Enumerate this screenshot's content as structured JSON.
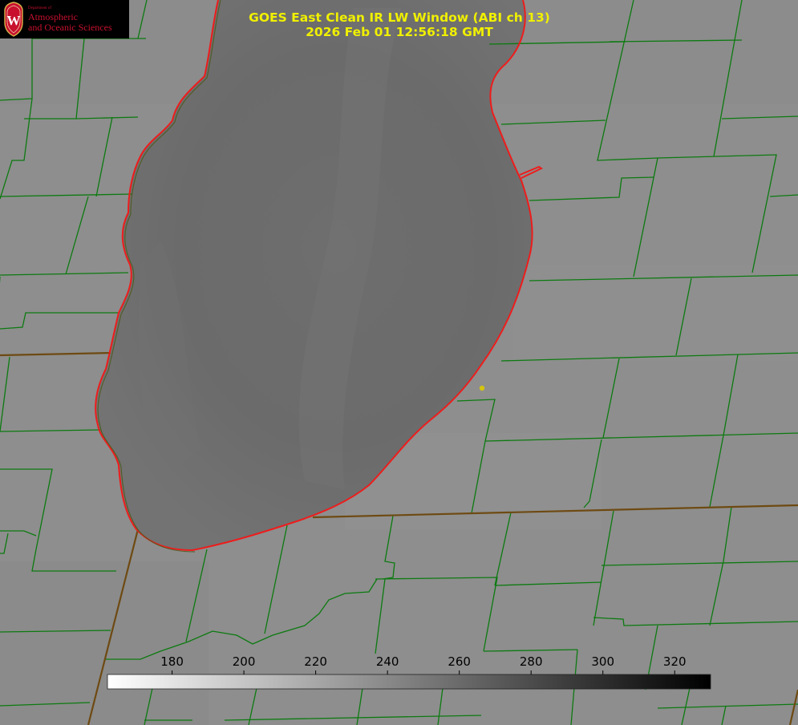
{
  "title": {
    "line1": "GOES East Clean IR LW Window (ABI ch 13)",
    "line2": "2026 Feb 01 12:56:18 GMT"
  },
  "logo": {
    "crest_letter": "W",
    "dept": "Department of",
    "line1": "Atmospheric",
    "line2": "and Oceanic Sciences"
  },
  "colorbar": {
    "min": 162,
    "max": 330,
    "ticks": [
      "180",
      "200",
      "220",
      "240",
      "260",
      "280",
      "300",
      "320"
    ],
    "tick_values": [
      180,
      200,
      220,
      240,
      260,
      280,
      300,
      320
    ],
    "start_color": "#ffffff",
    "end_color": "#000000"
  },
  "colors": {
    "land": "#8e8e8e",
    "lake": "#6a6a6a",
    "county_lines": "#0c7a10",
    "state_lines": "#6e4a12",
    "shoreline": "#ee1c1c",
    "title_text": "#f0f000",
    "marker": "#d4c410"
  }
}
